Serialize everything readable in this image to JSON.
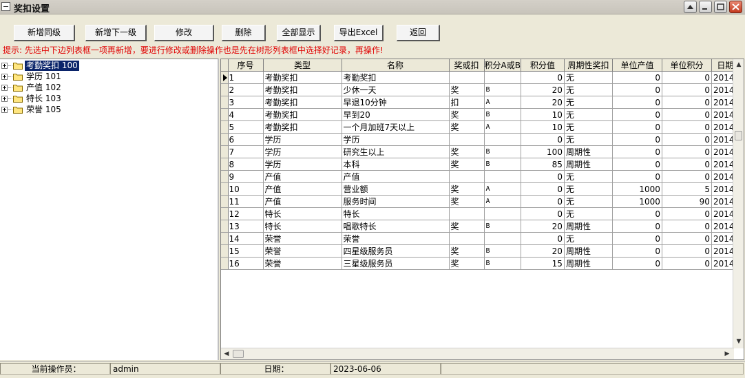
{
  "window": {
    "title": "奖扣设置"
  },
  "toolbar": {
    "add_sibling": "新增同级",
    "add_child": "新增下一级",
    "edit": "修改",
    "delete": "删除",
    "show_all": "全部显示",
    "export_excel": "导出Excel",
    "back": "返回"
  },
  "hint": "提示: 先选中下边列表框一项再新增，要进行修改或删除操作也是先在树形列表框中选择好记录，再操作!",
  "tree": [
    {
      "label": "考勤奖扣 100",
      "selected": true
    },
    {
      "label": "学历 101"
    },
    {
      "label": "产值 102"
    },
    {
      "label": "特长 103"
    },
    {
      "label": "荣誉 105"
    }
  ],
  "grid": {
    "columns": [
      "序号",
      "类型",
      "名称",
      "奖或扣",
      "积分A或B",
      "积分值",
      "周期性奖扣",
      "单位产值",
      "单位积分",
      "日期"
    ],
    "rows": [
      [
        "1",
        "考勤奖扣",
        "考勤奖扣",
        "",
        "",
        "0",
        "无",
        "0",
        "0",
        "2014-"
      ],
      [
        "2",
        "考勤奖扣",
        "少休一天",
        "奖",
        "B",
        "20",
        "无",
        "0",
        "0",
        "2014-"
      ],
      [
        "3",
        "考勤奖扣",
        "早退10分钟",
        "扣",
        "A",
        "20",
        "无",
        "0",
        "0",
        "2014-"
      ],
      [
        "4",
        "考勤奖扣",
        "早到20",
        "奖",
        "B",
        "10",
        "无",
        "0",
        "0",
        "2014-"
      ],
      [
        "5",
        "考勤奖扣",
        "一个月加班7天以上",
        "奖",
        "A",
        "10",
        "无",
        "0",
        "0",
        "2014-"
      ],
      [
        "6",
        "学历",
        "学历",
        "",
        "",
        "0",
        "无",
        "0",
        "0",
        "2014-"
      ],
      [
        "7",
        "学历",
        "研究生以上",
        "奖",
        "B",
        "100",
        "周期性",
        "0",
        "0",
        "2014-"
      ],
      [
        "8",
        "学历",
        "本科",
        "奖",
        "B",
        "85",
        "周期性",
        "0",
        "0",
        "2014-"
      ],
      [
        "9",
        "产值",
        "产值",
        "",
        "",
        "0",
        "无",
        "0",
        "0",
        "2014-"
      ],
      [
        "10",
        "产值",
        "营业额",
        "奖",
        "A",
        "0",
        "无",
        "1000",
        "5",
        "2014-"
      ],
      [
        "11",
        "产值",
        "服务时间",
        "奖",
        "A",
        "0",
        "无",
        "1000",
        "90",
        "2014-"
      ],
      [
        "12",
        "特长",
        "特长",
        "",
        "",
        "0",
        "无",
        "0",
        "0",
        "2014-"
      ],
      [
        "13",
        "特长",
        "唱歌特长",
        "奖",
        "B",
        "20",
        "周期性",
        "0",
        "0",
        "2014-"
      ],
      [
        "14",
        "荣誉",
        "荣誉",
        "",
        "",
        "0",
        "无",
        "0",
        "0",
        "2014-"
      ],
      [
        "15",
        "荣誉",
        "四星级服务员",
        "奖",
        "B",
        "20",
        "周期性",
        "0",
        "0",
        "2014-"
      ],
      [
        "16",
        "荣誉",
        "三星级服务员",
        "奖",
        "B",
        "15",
        "周期性",
        "0",
        "0",
        "2014-"
      ]
    ]
  },
  "status": {
    "operator_label": "当前操作员：",
    "operator_value": "admin",
    "date_label": "日期：",
    "date_value": "2023-06-06"
  }
}
